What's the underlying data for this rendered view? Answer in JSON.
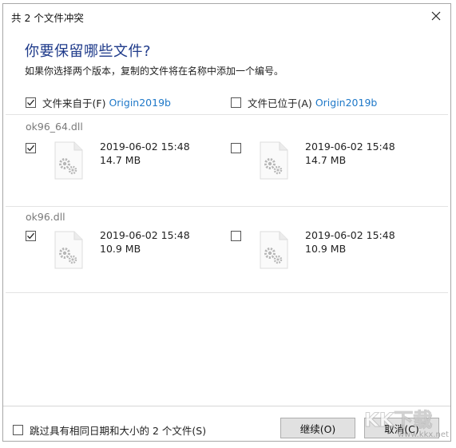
{
  "dialog": {
    "title": "共 2 个文件冲突",
    "heading": "你要保留哪些文件?",
    "subheading": "如果你选择两个版本，复制的文件将在名称中添加一个编号。"
  },
  "columns": {
    "source": {
      "label": "文件来自于(F)",
      "folder": "Origin2019b",
      "checked": true
    },
    "destination": {
      "label": "文件已位于(A)",
      "folder": "Origin2019b",
      "checked": false
    }
  },
  "files": [
    {
      "name": "ok96_64.dll",
      "source": {
        "date": "2019-06-02 15:48",
        "size": "14.7 MB",
        "checked": true
      },
      "destination": {
        "date": "2019-06-02 15:48",
        "size": "14.7 MB",
        "checked": false
      }
    },
    {
      "name": "ok96.dll",
      "source": {
        "date": "2019-06-02 15:48",
        "size": "10.9 MB",
        "checked": true
      },
      "destination": {
        "date": "2019-06-02 15:48",
        "size": "10.9 MB",
        "checked": false
      }
    }
  ],
  "footer": {
    "skip_label": "跳过具有相同日期和大小的 2 个文件(S)",
    "skip_checked": false,
    "continue_label": "继续(O)",
    "cancel_label": "取消(C)"
  },
  "watermark": {
    "brand": "KK下载",
    "url": "www.kkx.net"
  },
  "colors": {
    "heading": "#1e3a8a",
    "link": "#1e78c8",
    "group_name": "#7a7a7a"
  }
}
